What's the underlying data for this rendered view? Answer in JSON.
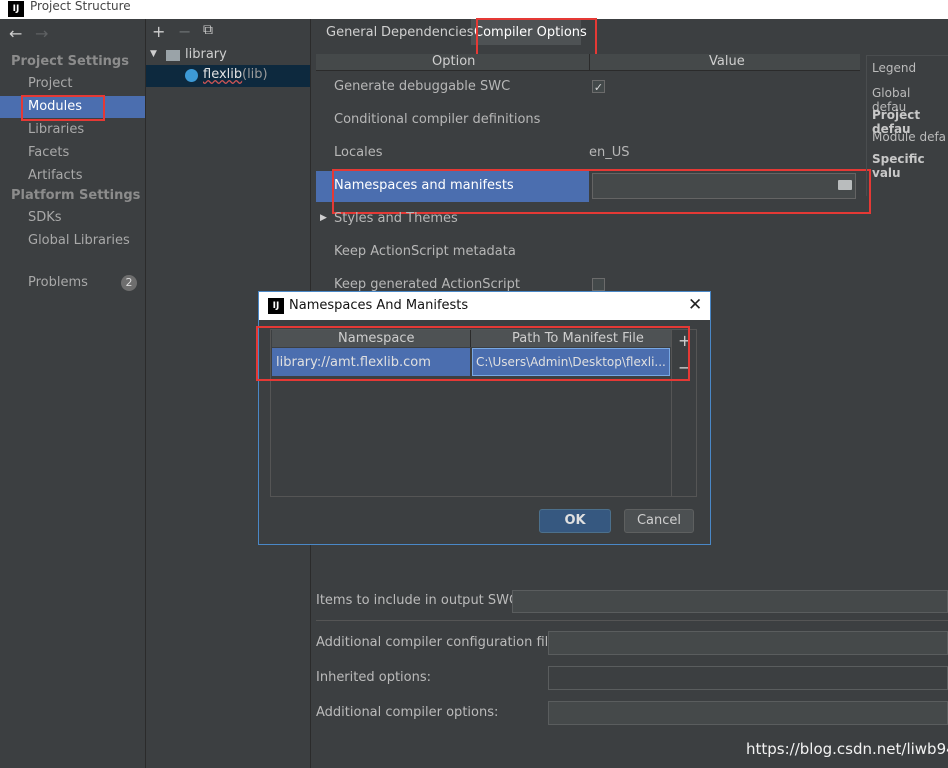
{
  "window": {
    "title": "Project Structure",
    "app_icon": "IJ"
  },
  "nav": {
    "back_icon": "←",
    "forward_icon": "→",
    "project_settings_header": "Project Settings",
    "project_items": [
      "Project",
      "Modules",
      "Libraries",
      "Facets",
      "Artifacts"
    ],
    "platform_settings_header": "Platform Settings",
    "platform_items": [
      "SDKs",
      "Global Libraries"
    ],
    "problems_label": "Problems",
    "problems_count": "2"
  },
  "tree": {
    "add_icon": "+",
    "remove_icon": "−",
    "copy_icon": "⧉",
    "root_label": "library",
    "child_label": "flexlib",
    "child_suffix": "(lib)"
  },
  "tabs": [
    "General",
    "Dependencies",
    "Compiler Options"
  ],
  "options_table": {
    "header_option": "Option",
    "header_value": "Value",
    "rows": {
      "debug_swc": "Generate debuggable SWC",
      "conditional": "Conditional compiler definitions",
      "locales": "Locales",
      "locales_value": "en_US",
      "namespaces": "Namespaces and manifests",
      "styles": "Styles and Themes",
      "keep_metadata": "Keep ActionScript metadata",
      "keep_generated": "Keep generated ActionScript"
    }
  },
  "legend": {
    "title": "Legend",
    "global": "Global defau",
    "project": "Project defau",
    "module": "Module defa",
    "specific": "Specific valu"
  },
  "bottom_fields": {
    "items_include": "Items to include in output SWC:",
    "additional_config": "Additional compiler configuration file:",
    "inherited": "Inherited options:",
    "additional_options": "Additional compiler options:"
  },
  "dialog": {
    "title": "Namespaces And Manifests",
    "col_namespace": "Namespace",
    "col_path": "Path To Manifest File",
    "row_namespace": "library://amt.flexlib.com",
    "row_path": "C:\\Users\\Admin\\Desktop\\flexli...",
    "add_icon": "+",
    "remove_icon": "−",
    "ok_label": "OK",
    "cancel_label": "Cancel",
    "close_icon": "✕"
  },
  "watermark": "https://blog.csdn.net/liwb94",
  "colors": {
    "selection": "#4b6eaf",
    "highlight_box": "#e53935",
    "background": "#3c3f41"
  }
}
